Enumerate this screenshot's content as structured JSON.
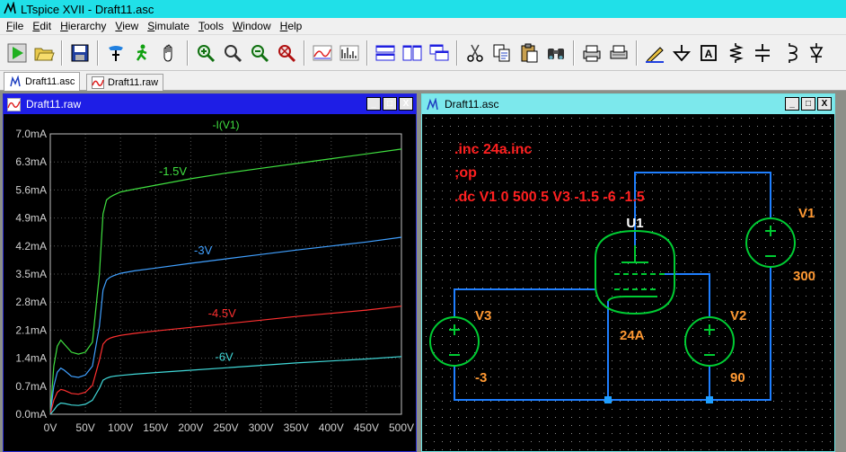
{
  "app": {
    "title": "LTspice XVII - Draft11.asc"
  },
  "menu": [
    {
      "label": "File",
      "hotkey": "F",
      "rest": "ile"
    },
    {
      "label": "Edit",
      "hotkey": "E",
      "rest": "dit"
    },
    {
      "label": "Hierarchy",
      "hotkey": "H",
      "rest": "ierarchy"
    },
    {
      "label": "View",
      "hotkey": "V",
      "rest": "iew"
    },
    {
      "label": "Simulate",
      "hotkey": "S",
      "rest": "imulate"
    },
    {
      "label": "Tools",
      "hotkey": "T",
      "rest": "ools"
    },
    {
      "label": "Window",
      "hotkey": "W",
      "rest": "indow"
    },
    {
      "label": "Help",
      "hotkey": "H",
      "rest": "elp"
    }
  ],
  "toolbar": {
    "icons": [
      "run-icon",
      "open-folder-icon",
      "save-icon",
      "control-panel-icon",
      "halt-icon",
      "pan-hand-icon",
      "zoom-in-icon",
      "zoom-out-icon",
      "zoom-back-icon",
      "zoom-fit-icon",
      "autorange-icon",
      "fft-icon",
      "tile-horizontal-icon",
      "tile-vertical-icon",
      "cascade-icon",
      "cut-icon",
      "copy-icon",
      "paste-icon",
      "find-icon",
      "print-icon",
      "print-setup-icon",
      "draw-wire-icon",
      "ground-icon",
      "label-net-icon",
      "resistor-icon",
      "capacitor-icon",
      "inductor-icon",
      "diode-icon"
    ]
  },
  "tabs": [
    {
      "label": "Draft11.asc",
      "icon": "schematic-icon",
      "active": true
    },
    {
      "label": "Draft11.raw",
      "icon": "waveform-icon",
      "active": false
    }
  ],
  "waveform_window": {
    "title": "Draft11.raw",
    "buttons": {
      "minimize": "_",
      "maximize": "□",
      "close": "X"
    }
  },
  "schematic_window": {
    "title": "Draft11.asc",
    "buttons": {
      "minimize": "_",
      "maximize": "□",
      "close": "X"
    },
    "directives": [
      ".inc 24a.inc",
      ";op",
      ".dc V1 0 500 5 V3 -1.5 -6 -1.5"
    ],
    "components": {
      "U1": {
        "ref": "U1",
        "value": "24A"
      },
      "V1": {
        "ref": "V1",
        "value": "300"
      },
      "V2": {
        "ref": "V2",
        "value": "90"
      },
      "V3": {
        "ref": "V3",
        "value": "-3"
      }
    },
    "colors": {
      "wire": "#1f7fff",
      "component": "#00cc33",
      "directive": "#ff2020",
      "label": "#ff9933",
      "grid": "#8a8a8a"
    }
  },
  "chart_data": {
    "type": "line",
    "title": "-I(V1)",
    "xlabel": "",
    "ylabel": "",
    "x_ticks": [
      "0V",
      "50V",
      "100V",
      "150V",
      "200V",
      "250V",
      "300V",
      "350V",
      "400V",
      "450V",
      "500V"
    ],
    "y_ticks": [
      "0.0mA",
      "0.7mA",
      "1.4mA",
      "2.1mA",
      "2.8mA",
      "3.5mA",
      "4.2mA",
      "4.9mA",
      "5.6mA",
      "6.3mA",
      "7.0mA"
    ],
    "xlim": [
      0,
      500
    ],
    "ylim": [
      0,
      7.0
    ],
    "grid": true,
    "x_unit": "V",
    "y_unit": "mA",
    "series": [
      {
        "name": "-1.5V",
        "color": "#40e040",
        "x": [
          0,
          5,
          10,
          15,
          20,
          30,
          40,
          50,
          60,
          70,
          75,
          80,
          85,
          90,
          100,
          120,
          150,
          200,
          250,
          300,
          350,
          400,
          450,
          500
        ],
        "y": [
          0,
          1.2,
          1.7,
          1.85,
          1.75,
          1.55,
          1.5,
          1.55,
          1.8,
          3.5,
          5.0,
          5.35,
          5.42,
          5.47,
          5.55,
          5.62,
          5.72,
          5.88,
          6.02,
          6.14,
          6.26,
          6.38,
          6.5,
          6.62
        ]
      },
      {
        "name": "-3V",
        "color": "#40a0ff",
        "x": [
          0,
          5,
          10,
          15,
          20,
          30,
          40,
          50,
          60,
          70,
          75,
          80,
          85,
          90,
          100,
          120,
          150,
          200,
          250,
          300,
          350,
          400,
          450,
          500
        ],
        "y": [
          0,
          0.7,
          1.05,
          1.15,
          1.1,
          0.95,
          0.92,
          0.98,
          1.2,
          2.2,
          3.1,
          3.35,
          3.42,
          3.46,
          3.52,
          3.58,
          3.65,
          3.77,
          3.88,
          3.99,
          4.1,
          4.2,
          4.3,
          4.42
        ]
      },
      {
        "name": "-4.5V",
        "color": "#ff3030",
        "x": [
          0,
          5,
          10,
          15,
          20,
          30,
          40,
          50,
          60,
          70,
          75,
          80,
          85,
          90,
          100,
          120,
          150,
          200,
          250,
          300,
          350,
          400,
          450,
          500
        ],
        "y": [
          0,
          0.35,
          0.55,
          0.62,
          0.6,
          0.52,
          0.5,
          0.55,
          0.72,
          1.35,
          1.75,
          1.85,
          1.9,
          1.93,
          1.97,
          2.02,
          2.08,
          2.17,
          2.26,
          2.35,
          2.44,
          2.52,
          2.6,
          2.7
        ]
      },
      {
        "name": "-6V",
        "color": "#40d8d8",
        "x": [
          0,
          5,
          10,
          15,
          20,
          30,
          40,
          50,
          60,
          70,
          75,
          80,
          85,
          90,
          100,
          120,
          150,
          200,
          250,
          300,
          350,
          400,
          450,
          500
        ],
        "y": [
          0,
          0.1,
          0.22,
          0.28,
          0.27,
          0.23,
          0.22,
          0.25,
          0.35,
          0.65,
          0.85,
          0.9,
          0.93,
          0.95,
          0.97,
          1.0,
          1.04,
          1.1,
          1.16,
          1.22,
          1.28,
          1.33,
          1.38,
          1.44
        ]
      }
    ],
    "series_label_anchor_x": [
      170,
      220,
      240,
      250
    ]
  }
}
